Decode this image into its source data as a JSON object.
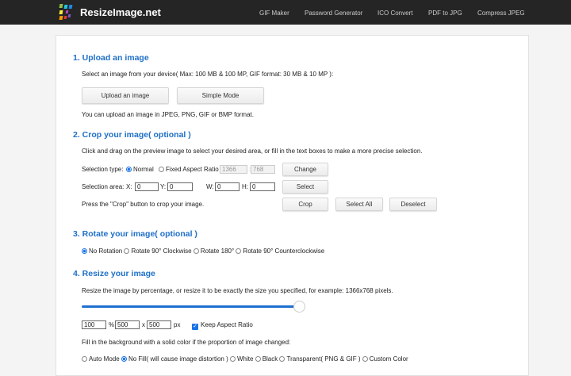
{
  "header": {
    "brand": "ResizeImage.net",
    "nav": [
      "GIF Maker",
      "Password Generator",
      "ICO Convert",
      "PDF to JPG",
      "Compress JPEG"
    ]
  },
  "upload": {
    "title": "1. Upload an image",
    "desc": "Select an image from your device( Max: 100 MB & 100 MP, GIF format: 30 MB & 10 MP ):",
    "upload_btn": "Upload an image",
    "simple_btn": "Simple Mode",
    "note": "You can upload an image in JPEG, PNG, GIF or BMP format."
  },
  "crop": {
    "title": "2. Crop your image( optional )",
    "desc": "Click and drag on the preview image to select your desired area, or fill in the text boxes to make a more precise selection.",
    "type_label": "Selection type:",
    "normal": "Normal",
    "fixed": "Fixed Aspect Ratio",
    "ratio_w": "1366",
    "ratio_sep": ":",
    "ratio_h": "768",
    "change_btn": "Change",
    "area_label": "Selection area:",
    "x_label": "X:",
    "x": "0",
    "y_label": "Y:",
    "y": "0",
    "w_label": "W:",
    "w": "0",
    "h_label": "H:",
    "h": "0",
    "select_btn": "Select",
    "press_note": "Press the \"Crop\" button to crop your image.",
    "crop_btn": "Crop",
    "select_all_btn": "Select All",
    "deselect_btn": "Deselect"
  },
  "rotate": {
    "title": "3. Rotate your image( optional )",
    "options": [
      "No Rotation",
      "Rotate 90° Clockwise",
      "Rotate 180°",
      "Rotate 90° Counterclockwise"
    ],
    "selected": 0
  },
  "resize": {
    "title": "4. Resize your image",
    "desc": "Resize the image by percentage, or resize it to be exactly the size you specified, for example: 1366x768 pixels.",
    "slider_percent": 100,
    "percent": "100",
    "percent_unit": "%",
    "width": "500",
    "x_sep": "x",
    "height": "500",
    "px_unit": "px",
    "keep_aspect": "Keep Aspect Ratio",
    "keep_aspect_checked": true,
    "fill_desc": "Fill in the background with a solid color if the proportion of image changed:",
    "fill_options": [
      "Auto Mode",
      "No Fill( will cause image distortion )",
      "White",
      "Black",
      "Transparent( PNG & GIF )",
      "Custom Color"
    ],
    "fill_selected": 1
  }
}
